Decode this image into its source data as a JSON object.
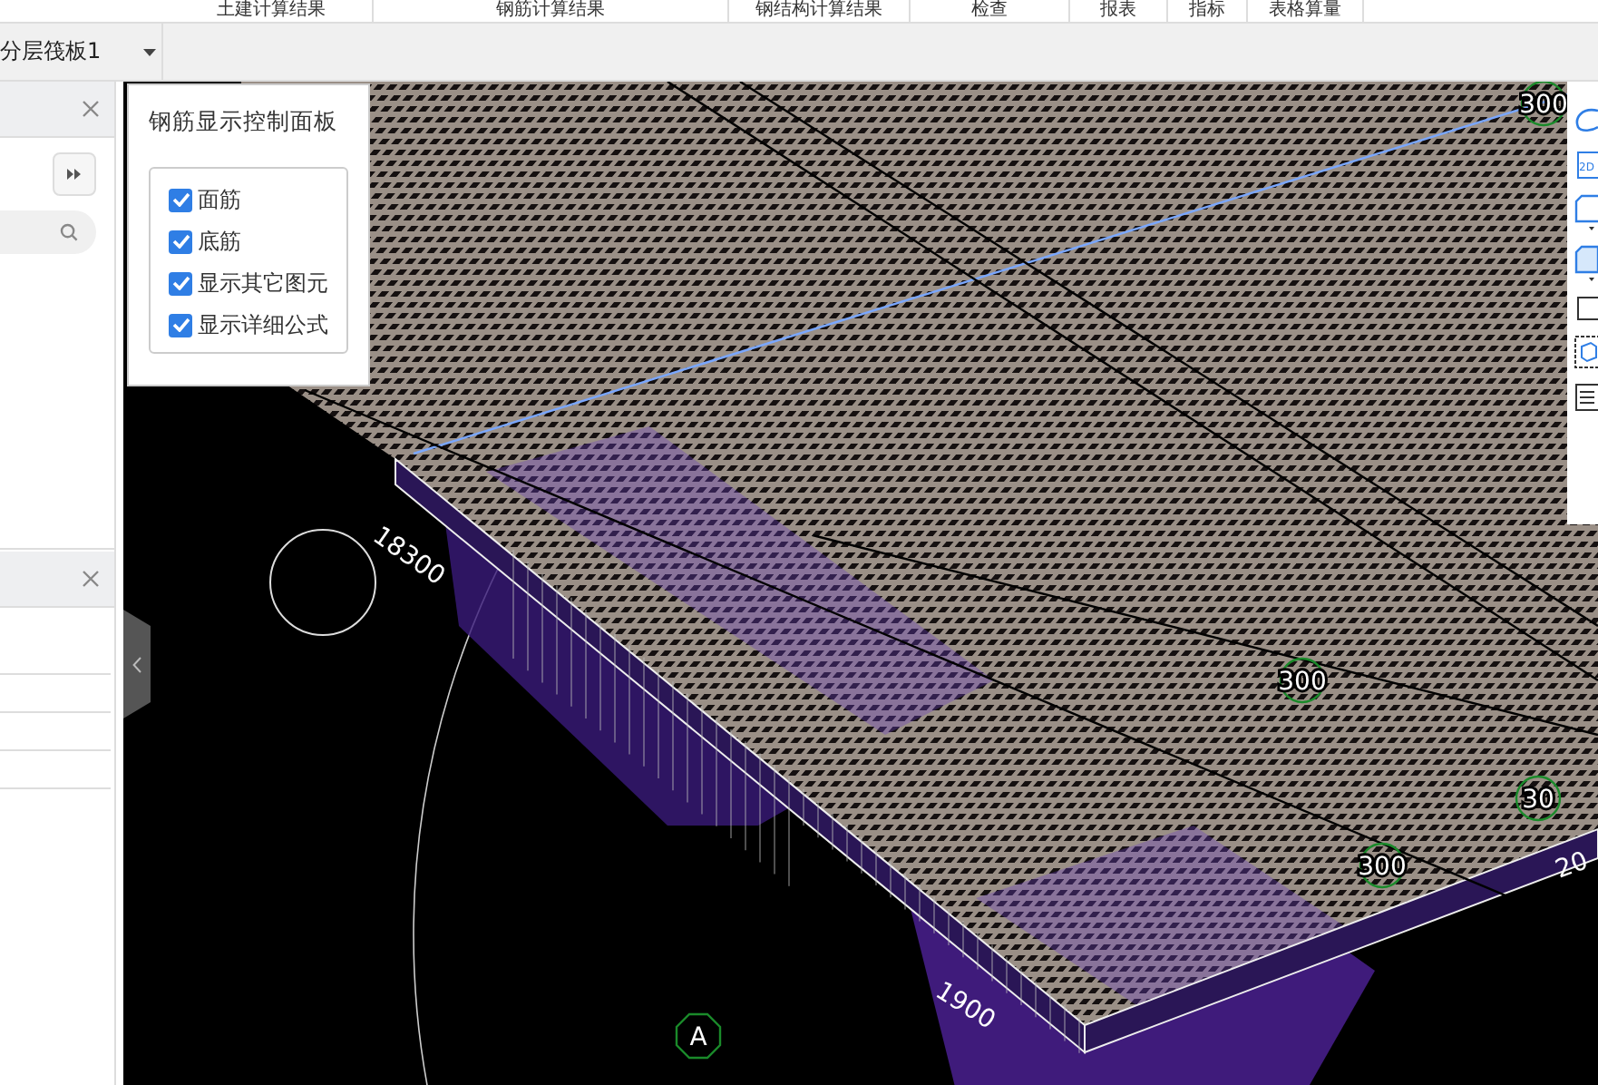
{
  "top_tabs": [
    "土建计算结果",
    "钢筋计算结果",
    "钢结构计算结果",
    "检查",
    "报表",
    "指标",
    "表格算量"
  ],
  "floor_select": {
    "value": "分层筏板1"
  },
  "view_2d_label": "2D",
  "control_panel": {
    "title": "钢筋显示控制面板",
    "options": [
      {
        "label": "面筋",
        "checked": true
      },
      {
        "label": "底筋",
        "checked": true
      },
      {
        "label": "显示其它图元",
        "checked": true
      },
      {
        "label": "显示详细公式",
        "checked": true
      }
    ]
  },
  "canvas_labels": [
    {
      "kind": "bubble",
      "text": "300"
    },
    {
      "kind": "dimension",
      "text": "18300"
    },
    {
      "kind": "bubble",
      "text": "300"
    },
    {
      "kind": "bubble",
      "text": "300"
    },
    {
      "kind": "dimension",
      "text": "1900"
    },
    {
      "kind": "bubble",
      "text": "30"
    },
    {
      "kind": "dimension",
      "text": "20"
    },
    {
      "kind": "axis",
      "text": "A"
    }
  ]
}
